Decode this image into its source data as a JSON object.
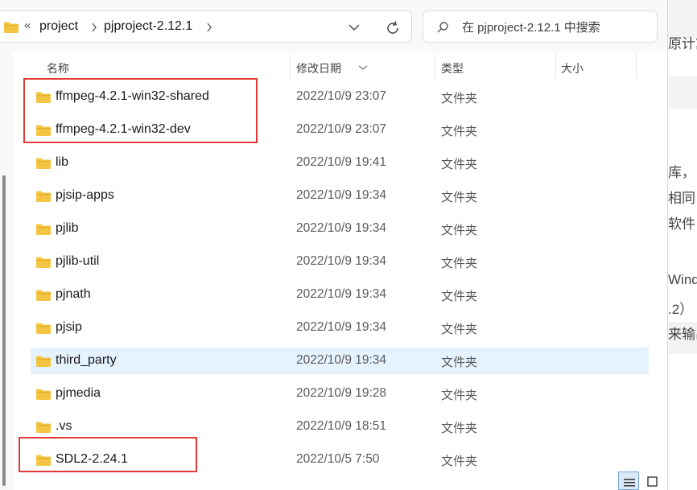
{
  "address_bar": {
    "overflow_glyph": "«",
    "crumbs": [
      "project",
      "pjproject-2.12.1"
    ]
  },
  "search": {
    "placeholder": "在 pjproject-2.12.1 中搜索"
  },
  "columns": {
    "name": "名称",
    "date": "修改日期",
    "type": "类型",
    "size": "大小"
  },
  "files": [
    {
      "name": "ffmpeg-4.2.1-win32-shared",
      "date": "2022/10/9 23:07",
      "type": "文件夹"
    },
    {
      "name": "ffmpeg-4.2.1-win32-dev",
      "date": "2022/10/9 23:07",
      "type": "文件夹"
    },
    {
      "name": "lib",
      "date": "2022/10/9 19:41",
      "type": "文件夹"
    },
    {
      "name": "pjsip-apps",
      "date": "2022/10/9 19:34",
      "type": "文件夹"
    },
    {
      "name": "pjlib",
      "date": "2022/10/9 19:34",
      "type": "文件夹"
    },
    {
      "name": "pjlib-util",
      "date": "2022/10/9 19:34",
      "type": "文件夹"
    },
    {
      "name": "pjnath",
      "date": "2022/10/9 19:34",
      "type": "文件夹"
    },
    {
      "name": "pjsip",
      "date": "2022/10/9 19:34",
      "type": "文件夹"
    },
    {
      "name": "third_party",
      "date": "2022/10/9 19:34",
      "type": "文件夹"
    },
    {
      "name": "pjmedia",
      "date": "2022/10/9 19:28",
      "type": "文件夹"
    },
    {
      "name": ".vs",
      "date": "2022/10/9 18:51",
      "type": "文件夹"
    },
    {
      "name": "SDL2-2.24.1",
      "date": "2022/10/5 7:50",
      "type": "文件夹"
    }
  ],
  "background_page": {
    "fragments": [
      "原计算",
      "库，",
      "相同",
      "软件",
      "Windo",
      ".2）",
      "来输出"
    ]
  },
  "colors": {
    "folder": "#f4c542",
    "selected_row": "#e5f3ff",
    "highlight_box": "#e53935"
  }
}
